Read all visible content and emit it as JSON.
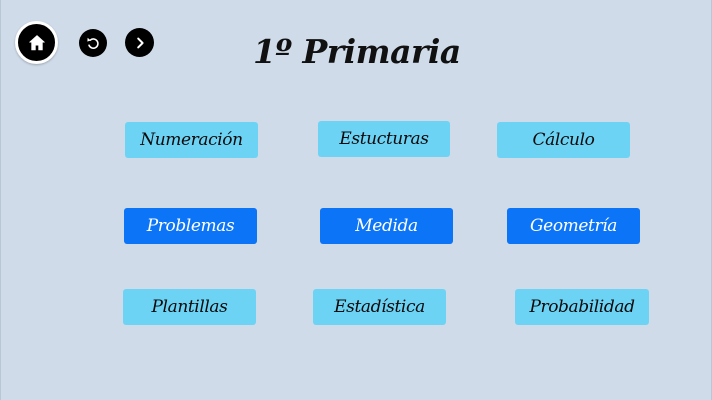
{
  "header": {
    "title": "1º Primaria"
  },
  "nav": {
    "home_icon": "home-icon",
    "back_icon": "undo-icon",
    "forward_icon": "chevron-right-icon"
  },
  "menu": {
    "numeracion": "Numeración",
    "estructuras": "Estucturas",
    "calculo": "Cálculo",
    "problemas": "Problemas",
    "medida": "Medida",
    "geometria": "Geometría",
    "plantillas": "Plantillas",
    "estadistica": "Estadística",
    "probabilidad": "Probabilidad"
  },
  "colors": {
    "background": "#cfdbe9",
    "button_light": "#6dd3f5",
    "button_dark": "#0b74f7",
    "nav_button": "#000000"
  }
}
